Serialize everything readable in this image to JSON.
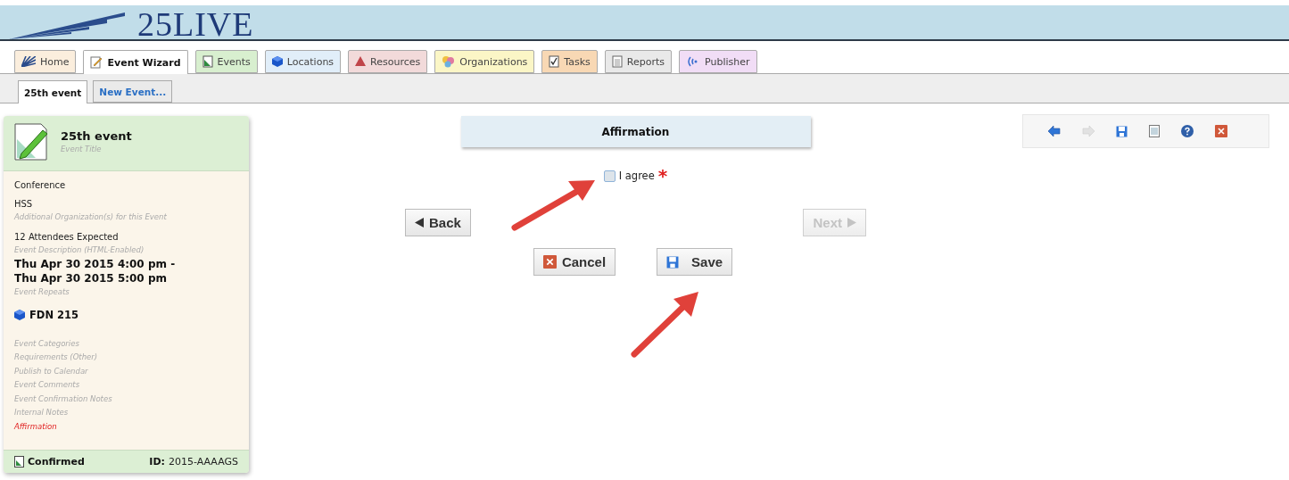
{
  "header": {
    "logo": "25LIVE"
  },
  "main_tabs": [
    {
      "label": "Home",
      "selected": false,
      "color": "#fbeedd"
    },
    {
      "label": "Event Wizard",
      "selected": true,
      "color": "#ffffff"
    },
    {
      "label": "Events",
      "selected": false,
      "color": "#d8efcf"
    },
    {
      "label": "Locations",
      "selected": false,
      "color": "#e1eef9"
    },
    {
      "label": "Resources",
      "selected": false,
      "color": "#f2dada"
    },
    {
      "label": "Organizations",
      "selected": false,
      "color": "#fbf6c6"
    },
    {
      "label": "Tasks",
      "selected": false,
      "color": "#f8d8b4"
    },
    {
      "label": "Reports",
      "selected": false,
      "color": "#e9e9e9"
    },
    {
      "label": "Publisher",
      "selected": false,
      "color": "#f1ddf6"
    }
  ],
  "sub_tabs": [
    {
      "label": "25th event",
      "selected": true
    },
    {
      "label": "New Event...",
      "selected": false
    }
  ],
  "summary": {
    "title": "25th event",
    "title_hint": "Event Title",
    "items": [
      {
        "kind": "text",
        "text": "Conference"
      },
      {
        "kind": "text",
        "text": "HSS"
      },
      {
        "kind": "hint",
        "text": "Additional Organization(s) for this Event"
      },
      {
        "kind": "text",
        "text": "12 Attendees Expected"
      },
      {
        "kind": "hint",
        "text": "Event Description (HTML-Enabled)"
      },
      {
        "kind": "date",
        "text": "Thu Apr 30 2015 4:00 pm -\nThu Apr 30 2015 5:00 pm"
      },
      {
        "kind": "hint",
        "text": "Event Repeats"
      },
      {
        "kind": "location",
        "text": "FDN 215"
      },
      {
        "kind": "step",
        "text": "Event Categories",
        "current": false
      },
      {
        "kind": "step",
        "text": "Requirements (Other)",
        "current": false
      },
      {
        "kind": "step",
        "text": "Publish to Calendar",
        "current": false
      },
      {
        "kind": "step",
        "text": "Event Comments",
        "current": false
      },
      {
        "kind": "step",
        "text": "Event Confirmation Notes",
        "current": false
      },
      {
        "kind": "step",
        "text": "Internal Notes",
        "current": false
      },
      {
        "kind": "step",
        "text": "Affirmation",
        "current": true
      }
    ],
    "status": "Confirmed",
    "id_label": "ID:",
    "id_value": "2015-AAAAGS"
  },
  "wizard": {
    "heading": "Affirmation",
    "agree": {
      "label": "I agree",
      "checked": false,
      "required_mark": "*"
    },
    "back": {
      "label": "Back",
      "disabled": false
    },
    "next": {
      "label": "Next",
      "disabled": true
    },
    "cancel": {
      "label": "Cancel"
    },
    "save": {
      "label": "Save"
    }
  },
  "toolbar": [
    {
      "kind": "back",
      "disabled": false
    },
    {
      "kind": "forward",
      "disabled": true
    },
    {
      "kind": "save",
      "disabled": false
    },
    {
      "kind": "document",
      "disabled": false
    },
    {
      "kind": "help",
      "disabled": false
    },
    {
      "kind": "close",
      "disabled": false
    }
  ]
}
